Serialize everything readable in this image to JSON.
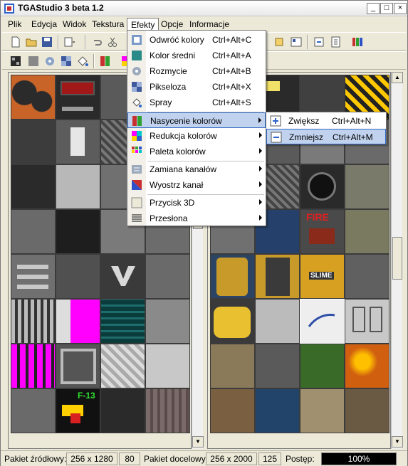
{
  "window": {
    "title": "TGAStudio 3 beta 1.2",
    "minimize_glyph": "_",
    "maximize_glyph": "□",
    "close_glyph": "×"
  },
  "menubar": {
    "items": [
      "Plik",
      "Edycja",
      "Widok",
      "Tekstura",
      "Efekty",
      "Opcje",
      "Informacje"
    ],
    "active": "Efekty"
  },
  "effects_menu": {
    "items": [
      {
        "label": "Odwróć kolory",
        "shortcut": "Ctrl+Alt+C",
        "icon": "invert-icon"
      },
      {
        "label": "Kolor średni",
        "shortcut": "Ctrl+Alt+A",
        "icon": "average-color-icon"
      },
      {
        "label": "Rozmycie",
        "shortcut": "Ctrl+Alt+B",
        "icon": "blur-icon"
      },
      {
        "label": "Pikseloza",
        "shortcut": "Ctrl+Alt+X",
        "icon": "pixelate-icon"
      },
      {
        "label": "Spray",
        "shortcut": "Ctrl+Alt+S",
        "icon": "spray-icon"
      },
      {
        "label": "Nasycenie kolorów",
        "shortcut": "",
        "icon": "saturation-icon",
        "submenu": true,
        "highlighted": true
      },
      {
        "label": "Redukcja kolorów",
        "shortcut": "",
        "icon": "color-reduction-icon",
        "submenu": true
      },
      {
        "label": "Paleta kolorów",
        "shortcut": "",
        "icon": "palette-icon",
        "submenu": true
      },
      {
        "label": "Zamiana kanałów",
        "shortcut": "",
        "icon": "channel-swap-icon",
        "submenu": true
      },
      {
        "label": "Wyostrz kanał",
        "shortcut": "",
        "icon": "sharpen-icon",
        "submenu": true
      },
      {
        "label": "Przycisk 3D",
        "shortcut": "",
        "icon": "button-3d-icon",
        "submenu": true
      },
      {
        "label": "Przesłona",
        "shortcut": "",
        "icon": "shutter-icon",
        "submenu": true
      }
    ]
  },
  "saturation_submenu": {
    "items": [
      {
        "label": "Zwiększ",
        "shortcut": "Ctrl+Alt+N",
        "icon": "increase-icon"
      },
      {
        "label": "Zmniejsz",
        "shortcut": "Ctrl+Alt+M",
        "icon": "decrease-icon",
        "highlighted": true
      }
    ]
  },
  "tile_labels": {
    "fire_sign": "FIRE",
    "slime_sign": "SLIME",
    "f13_sign": "F-13"
  },
  "statusbar": {
    "source_label": "Pakiet źródłowy:",
    "source_size": "256 x 1280",
    "source_count": "80",
    "target_label": "Pakiet docelowy:",
    "target_size": "256 x 2000",
    "target_count": "125",
    "progress_label": "Postęp:",
    "progress_text": "100%",
    "progress_value": 1.0
  },
  "colors": {
    "menu_highlight": "#c1d2ee",
    "menu_highlight_border": "#316ac5",
    "magenta": "#ff00ff",
    "progress_bar": "#000000"
  }
}
